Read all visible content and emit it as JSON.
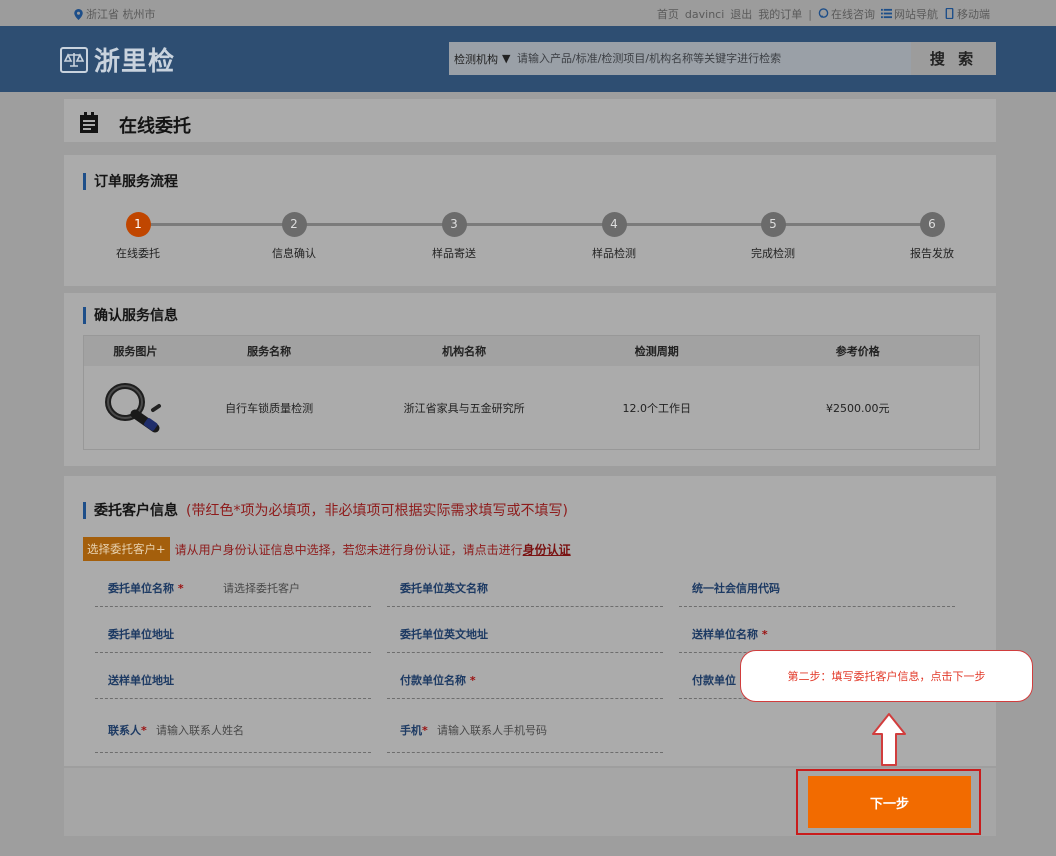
{
  "topbar": {
    "location": "浙江省 杭州市",
    "links": [
      "首页",
      "davinci",
      "退出",
      "我的订单"
    ],
    "separator": "|",
    "online_consult": "在线咨询",
    "site_nav": "网站导航",
    "mobile": "移动端"
  },
  "header": {
    "logo_text": "浙里检",
    "search_category": "检测机构",
    "search_placeholder": "请输入产品/标准/检测项目/机构名称等关键字进行检索",
    "search_button": "搜 索"
  },
  "page_title": "在线委托",
  "flow": {
    "heading": "订单服务流程",
    "steps": [
      {
        "num": "1",
        "label": "在线委托"
      },
      {
        "num": "2",
        "label": "信息确认"
      },
      {
        "num": "3",
        "label": "样品寄送"
      },
      {
        "num": "4",
        "label": "样品检测"
      },
      {
        "num": "5",
        "label": "完成检测"
      },
      {
        "num": "6",
        "label": "报告发放"
      }
    ],
    "active_step": 1
  },
  "service": {
    "heading": "确认服务信息",
    "columns": [
      "服务图片",
      "服务名称",
      "机构名称",
      "检测周期",
      "参考价格"
    ],
    "row": {
      "image_icon": "bike-lock-icon",
      "name": "自行车锁质量检测",
      "institution": "浙江省家具与五金研究所",
      "period": "12.0个工作日",
      "price": "¥2500.00元"
    }
  },
  "customer": {
    "heading": "委托客户信息",
    "note": "(带红色*项为必填项，非必填项可根据实际需求填写或不填写)",
    "choose_button": "选择委托客户+",
    "hint": "请从用户身份认证信息中选择，若您未进行身份认证，请点击进行",
    "id_link": "身份认证",
    "fields": {
      "unit_name": {
        "label": "委托单位名称",
        "required": "*",
        "placeholder": "请选择委托客户"
      },
      "unit_en_name": {
        "label": "委托单位英文名称"
      },
      "credit_code": {
        "label": "统一社会信用代码"
      },
      "unit_address": {
        "label": "委托单位地址"
      },
      "unit_en_address": {
        "label": "委托单位英文地址"
      },
      "sender_name": {
        "label": "送样单位名称",
        "required": "*"
      },
      "sender_address": {
        "label": "送样单位地址"
      },
      "payer_name": {
        "label": "付款单位名称",
        "required": "*"
      },
      "payer_partial": {
        "label": "付款单位"
      },
      "contact": {
        "label": "联系人",
        "required": "*",
        "placeholder": "请输入联系人姓名"
      },
      "phone": {
        "label": "手机",
        "required": "*",
        "placeholder": "请输入联系人手机号码"
      }
    }
  },
  "tooltip": "第二步：填写委托客户信息，点击下一步",
  "next_button": "下一步",
  "colors": {
    "header": "#2e4e72",
    "active_step": "#c04600",
    "next": "#f26b00",
    "highlight": "#c91c1c"
  }
}
